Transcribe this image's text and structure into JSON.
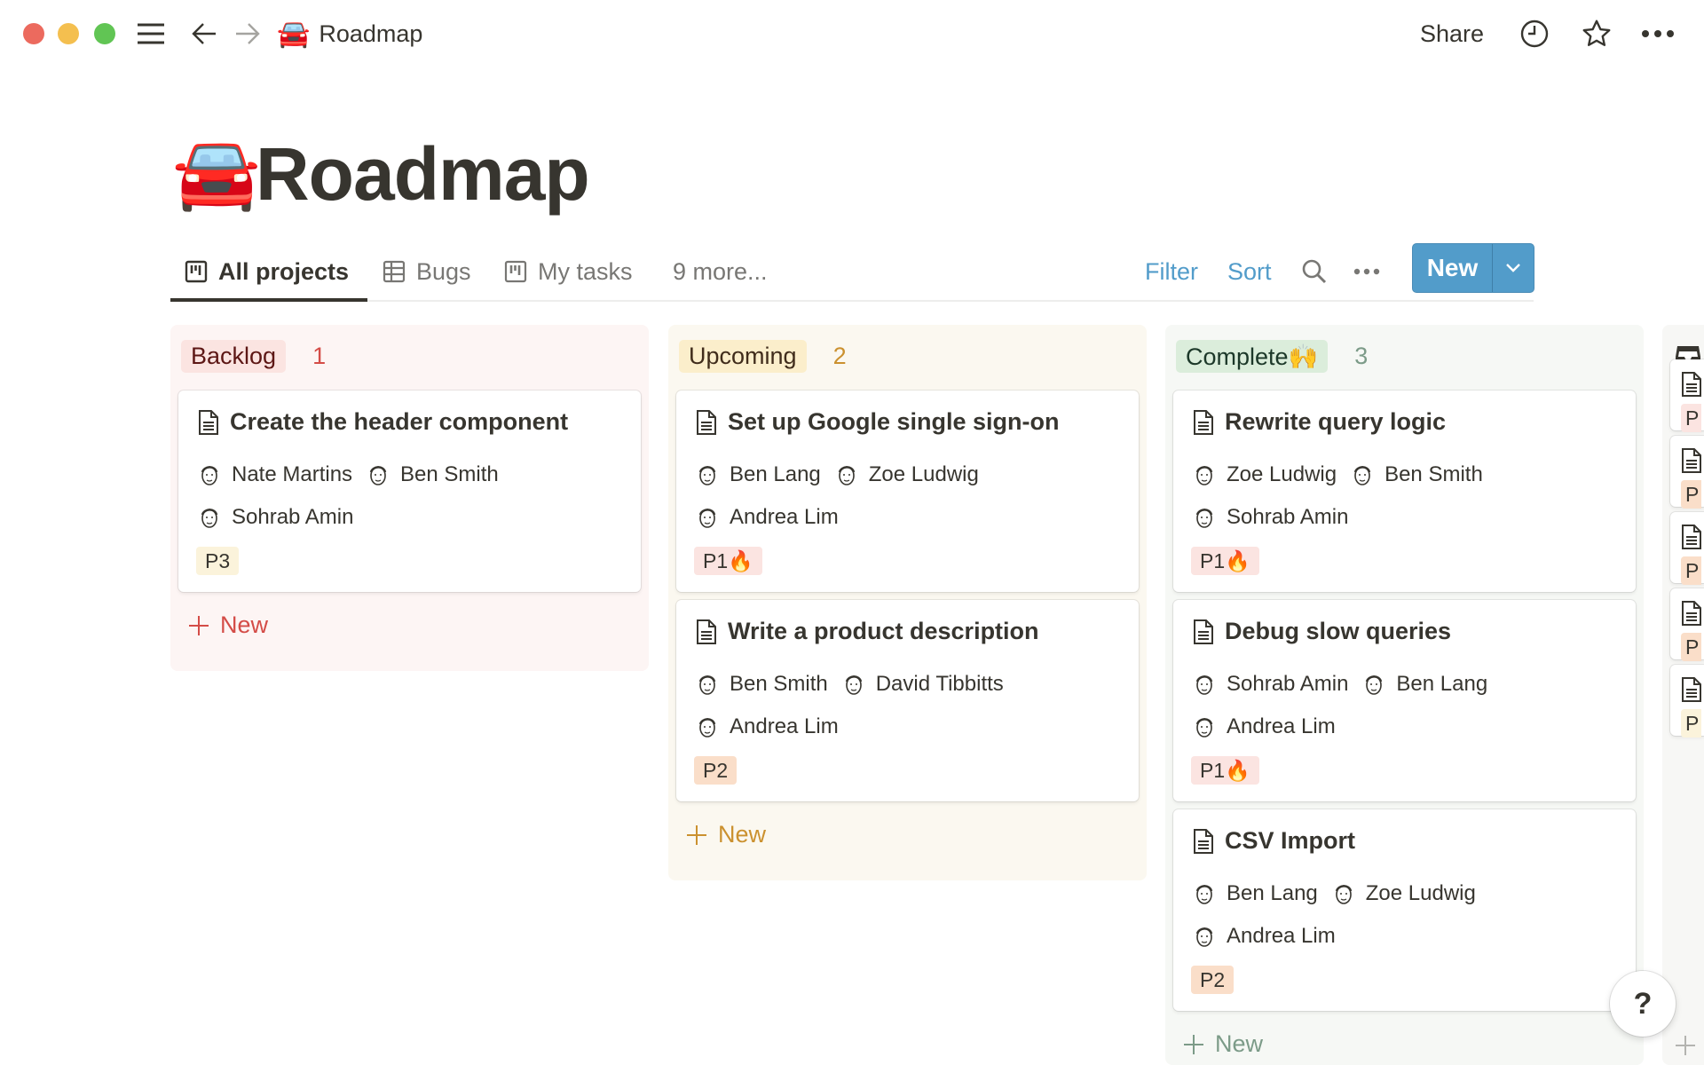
{
  "window": {
    "title": "Roadmap",
    "title_emoji": "🚘",
    "share_label": "Share"
  },
  "page": {
    "title": "Roadmap",
    "emoji": "🚘"
  },
  "views": {
    "tabs": [
      {
        "label": "All projects",
        "icon": "board-icon",
        "active": true
      },
      {
        "label": "Bugs",
        "icon": "table-icon",
        "active": false
      },
      {
        "label": "My tasks",
        "icon": "board-icon",
        "active": false
      },
      {
        "label": "9 more...",
        "icon": "",
        "active": false
      }
    ],
    "filter_label": "Filter",
    "sort_label": "Sort",
    "new_label": "New",
    "accent": "#529cca"
  },
  "board": {
    "columns": [
      {
        "name": "Backlog",
        "count": "1",
        "bg": "#fdf5f4",
        "pill_bg": "#fbe4e1",
        "pill_fg": "#5d1715",
        "count_fg": "#d44c47",
        "new_label": "New",
        "cards": [
          {
            "title": "Create the header component",
            "people_row1": [
              "Nate Martins",
              "Ben Smith"
            ],
            "people_row2": [
              "Sohrab Amin"
            ],
            "tag": "P3",
            "tag_bg": "#fbf3db"
          }
        ]
      },
      {
        "name": "Upcoming",
        "count": "2",
        "bg": "#fbf8f0",
        "pill_bg": "#fbeecb",
        "pill_fg": "#402c1b",
        "count_fg": "#cb912f",
        "new_label": "New",
        "cards": [
          {
            "title": "Set up Google single sign-on",
            "people_row1": [
              "Ben Lang",
              "Zoe Ludwig"
            ],
            "people_row2": [
              "Andrea Lim"
            ],
            "tag": "P1🔥",
            "tag_bg": "#fbe4e1"
          },
          {
            "title": "Write a product description",
            "people_row1": [
              "Ben Smith",
              "David Tibbitts"
            ],
            "people_row2": [
              "Andrea Lim"
            ],
            "tag": "P2",
            "tag_bg": "#fadec9"
          }
        ]
      },
      {
        "name": "Complete🙌",
        "count": "3",
        "bg": "#f6f8f5",
        "pill_bg": "#dbeddb",
        "pill_fg": "#1c3829",
        "count_fg": "#7c9b88",
        "new_label": "New",
        "cards": [
          {
            "title": "Rewrite query logic",
            "people_row1": [
              "Zoe Ludwig",
              "Ben Smith"
            ],
            "people_row2": [
              "Sohrab Amin"
            ],
            "tag": "P1🔥",
            "tag_bg": "#fbe4e1"
          },
          {
            "title": "Debug slow queries",
            "people_row1": [
              "Sohrab Amin",
              "Ben Lang"
            ],
            "people_row2": [
              "Andrea Lim"
            ],
            "tag": "P1🔥",
            "tag_bg": "#fbe4e1"
          },
          {
            "title": "CSV Import",
            "people_row1": [
              "Ben Lang",
              "Zoe Ludwig"
            ],
            "people_row2": [
              "Andrea Lim"
            ],
            "tag": "P2",
            "tag_bg": "#fadec9"
          }
        ]
      }
    ],
    "partial_column": {
      "icon": "inbox-icon",
      "cards": [
        {
          "tag": "P",
          "tag_bg": "#fbe4e1"
        },
        {
          "tag": "P",
          "tag_bg": "#fadec9"
        },
        {
          "tag": "P",
          "tag_bg": "#fadec9"
        },
        {
          "tag": "P",
          "tag_bg": "#fadec9"
        },
        {
          "tag": "P",
          "tag_bg": "#fbf3db"
        }
      ]
    }
  },
  "help": {
    "label": "?"
  }
}
